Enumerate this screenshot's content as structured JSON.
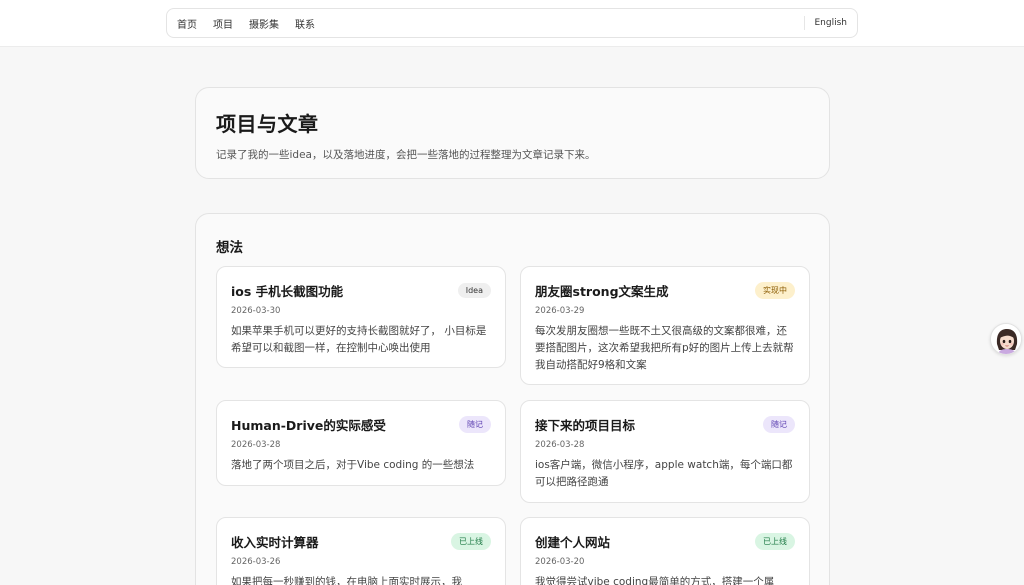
{
  "nav": {
    "items": [
      {
        "label": "首页"
      },
      {
        "label": "项目"
      },
      {
        "label": "摄影集"
      },
      {
        "label": "联系"
      }
    ],
    "language": "English"
  },
  "hero": {
    "title": "项目与文章",
    "subtitle": "记录了我的一些idea，以及落地进度，会把一些落地的过程整理为文章记录下来。"
  },
  "ideas": {
    "title": "想法",
    "cards": [
      {
        "title": "ios 手机长截图功能",
        "badge": "Idea",
        "date": "2026-03-30",
        "desc": "如果苹果手机可以更好的支持长截图就好了， 小目标是希望可以和截图一样，在控制中心唤出使用"
      },
      {
        "title": "朋友圈strong文案生成",
        "badge": "实现中",
        "date": "2026-03-29",
        "desc": "每次发朋友圈想一些既不土又很高级的文案都很难，还要搭配图片，这次希望我把所有p好的图片上传上去就帮我自动搭配好9格和文案"
      },
      {
        "title": "Human-Drive的实际感受",
        "badge": "随记",
        "date": "2026-03-28",
        "desc": "落地了两个项目之后，对于Vibe coding 的一些想法"
      },
      {
        "title": "接下来的项目目标",
        "badge": "随记",
        "date": "2026-03-28",
        "desc": "ios客户端，微信小程序，apple watch端，每个端口都可以把路径跑通"
      },
      {
        "title": "收入实时计算器",
        "badge": "已上线",
        "date": "2026-03-26",
        "desc": "如果把每一秒赚到的钱，在电脑上面实时展示，我"
      },
      {
        "title": "创建个人网站",
        "badge": "已上线",
        "date": "2026-03-20",
        "desc": "我觉得尝试vibe coding最简单的方式，搭建一个属"
      }
    ]
  },
  "colors": {
    "badge_idea_bg": "#efefef",
    "badge_idea_fg": "#333333",
    "badge_progress_bg": "#fdf0cc",
    "badge_progress_fg": "#8a5a00",
    "badge_note_bg": "#ece6fb",
    "badge_note_fg": "#5b3fb0",
    "badge_live_bg": "#d9f5e3",
    "badge_live_fg": "#1e7a45"
  },
  "avatar": {
    "icon": "avatar-girl-icon"
  }
}
